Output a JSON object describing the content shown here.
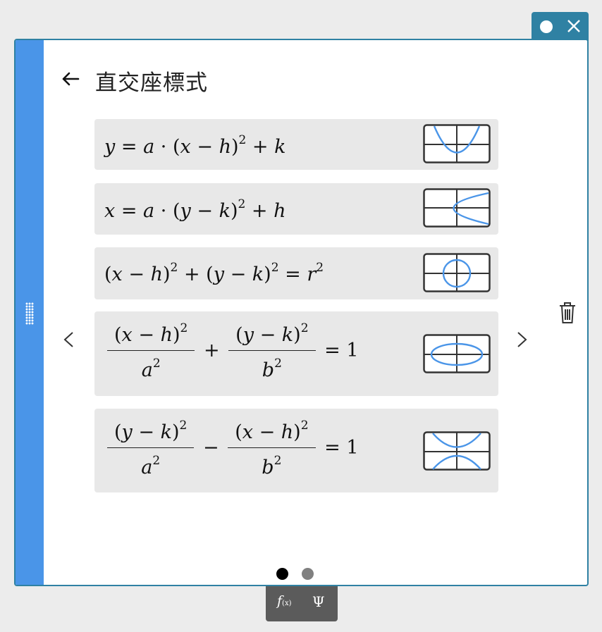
{
  "colors": {
    "accent": "#2f81a3",
    "sidebar": "#4a95e8",
    "card_bg": "#e8e8e8",
    "curve": "#4a95e8",
    "frame": "#333333",
    "pager_active": "#000000",
    "pager_inactive": "#808080",
    "toolbar_bg": "#5b5b5b"
  },
  "header": {
    "title": "直交座標式"
  },
  "cards": [
    {
      "name": "vertical-parabola",
      "icon": "vertical-parabola-graph-icon"
    },
    {
      "name": "horizontal-parabola",
      "icon": "horizontal-parabola-graph-icon"
    },
    {
      "name": "circle",
      "icon": "circle-graph-icon"
    },
    {
      "name": "ellipse",
      "icon": "ellipse-graph-icon"
    },
    {
      "name": "hyperbola",
      "icon": "hyperbola-graph-icon"
    }
  ],
  "formulas": {
    "f1": {
      "y": "y",
      "eq": "=",
      "a": "a",
      "dot": "·",
      "lp": "(",
      "x": "x",
      "minus": "−",
      "h": "h",
      "rp": ")",
      "sq": "2",
      "plus": "+",
      "k": "k"
    },
    "f2": {
      "x": "x",
      "eq": "=",
      "a": "a",
      "dot": "·",
      "lp": "(",
      "y": "y",
      "minus": "−",
      "k": "k",
      "rp": ")",
      "sq": "2",
      "plus": "+",
      "h": "h"
    },
    "f3": {
      "lp": "(",
      "x": "x",
      "minus": "−",
      "h": "h",
      "rp": ")",
      "sq": "2",
      "plus": "+",
      "y": "y",
      "k": "k",
      "eq": "=",
      "r": "r"
    },
    "f4": {
      "lp": "(",
      "x": "x",
      "minus": "−",
      "h": "h",
      "rp": ")",
      "sq": "2",
      "plus": "+",
      "y": "y",
      "k": "k",
      "a": "a",
      "b": "b",
      "eq": "=",
      "one": "1"
    },
    "f5": {
      "lp": "(",
      "y": "y",
      "minus": "−",
      "k": "k",
      "rp": ")",
      "sq": "2",
      "x": "x",
      "h": "h",
      "a": "a",
      "b": "b",
      "eq": "=",
      "one": "1"
    }
  },
  "pager": {
    "pages": 2,
    "current": 1
  },
  "toolbar": {
    "fx_f": "f",
    "fx_x": "(x)",
    "psi": "Ψ"
  }
}
